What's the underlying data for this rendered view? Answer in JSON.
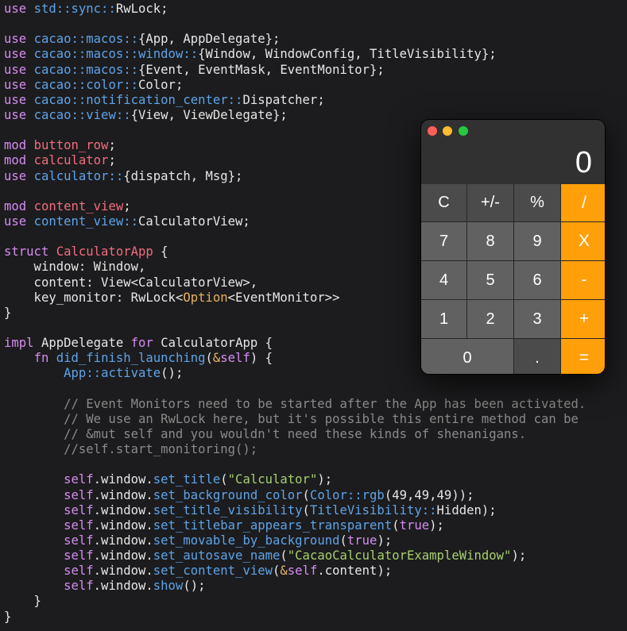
{
  "code_lines": [
    [
      [
        "kw",
        "use "
      ],
      [
        "ns",
        "std::sync::"
      ],
      [
        "pl",
        "RwLock;"
      ]
    ],
    [],
    [
      [
        "kw",
        "use "
      ],
      [
        "ns",
        "cacao::macos::"
      ],
      [
        "pl",
        "{App, AppDelegate};"
      ]
    ],
    [
      [
        "kw",
        "use "
      ],
      [
        "ns",
        "cacao::macos::window::"
      ],
      [
        "pl",
        "{Window, WindowConfig, TitleVisibility};"
      ]
    ],
    [
      [
        "kw",
        "use "
      ],
      [
        "ns",
        "cacao::macos::"
      ],
      [
        "pl",
        "{Event, EventMask, EventMonitor};"
      ]
    ],
    [
      [
        "kw",
        "use "
      ],
      [
        "ns",
        "cacao::color::"
      ],
      [
        "pl",
        "Color;"
      ]
    ],
    [
      [
        "kw",
        "use "
      ],
      [
        "ns",
        "cacao::notification_center::"
      ],
      [
        "pl",
        "Dispatcher;"
      ]
    ],
    [
      [
        "kw",
        "use "
      ],
      [
        "ns",
        "cacao::view::"
      ],
      [
        "pl",
        "{View, ViewDelegate};"
      ]
    ],
    [],
    [
      [
        "kw",
        "mod "
      ],
      [
        "name",
        "button_row"
      ],
      [
        "pl",
        ";"
      ]
    ],
    [
      [
        "kw",
        "mod "
      ],
      [
        "name",
        "calculator"
      ],
      [
        "pl",
        ";"
      ]
    ],
    [
      [
        "kw",
        "use "
      ],
      [
        "ns",
        "calculator::"
      ],
      [
        "pl",
        "{dispatch, Msg};"
      ]
    ],
    [],
    [
      [
        "kw",
        "mod "
      ],
      [
        "name",
        "content_view"
      ],
      [
        "pl",
        ";"
      ]
    ],
    [
      [
        "kw",
        "use "
      ],
      [
        "ns",
        "content_view::"
      ],
      [
        "pl",
        "CalculatorView;"
      ]
    ],
    [],
    [
      [
        "kw",
        "struct "
      ],
      [
        "name",
        "CalculatorApp"
      ],
      [
        "pl",
        " {"
      ]
    ],
    [
      [
        "pl",
        "    window: Window,"
      ]
    ],
    [
      [
        "pl",
        "    content: View<CalculatorView>,"
      ]
    ],
    [
      [
        "pl",
        "    key_monitor: RwLock<"
      ],
      [
        "opt",
        "Option"
      ],
      [
        "pl",
        "<EventMonitor>>"
      ]
    ],
    [
      [
        "pl",
        "}"
      ]
    ],
    [],
    [
      [
        "kw",
        "impl "
      ],
      [
        "pl",
        "AppDelegate "
      ],
      [
        "kw",
        "for "
      ],
      [
        "pl",
        "CalculatorApp {"
      ]
    ],
    [
      [
        "pl",
        "    "
      ],
      [
        "kw",
        "fn "
      ],
      [
        "fn",
        "did_finish_launching"
      ],
      [
        "pl",
        "("
      ],
      [
        "amp",
        "&"
      ],
      [
        "sf",
        "self"
      ],
      [
        "pl",
        ") {"
      ]
    ],
    [
      [
        "pl",
        "        "
      ],
      [
        "ns",
        "App::"
      ],
      [
        "fn",
        "activate"
      ],
      [
        "pl",
        "();"
      ]
    ],
    [],
    [
      [
        "cm",
        "        // Event Monitors need to be started after the App has been activated."
      ]
    ],
    [
      [
        "cm",
        "        // We use an RwLock here, but it's possible this entire method can be"
      ]
    ],
    [
      [
        "cm",
        "        // &mut self and you wouldn't need these kinds of shenanigans."
      ]
    ],
    [
      [
        "cm",
        "        //self.start_monitoring();"
      ]
    ],
    [],
    [
      [
        "pl",
        "        "
      ],
      [
        "sf",
        "self"
      ],
      [
        "pl",
        ".window."
      ],
      [
        "fn",
        "set_title"
      ],
      [
        "pl",
        "("
      ],
      [
        "str",
        "\"Calculator\""
      ],
      [
        "pl",
        ");"
      ]
    ],
    [
      [
        "pl",
        "        "
      ],
      [
        "sf",
        "self"
      ],
      [
        "pl",
        ".window."
      ],
      [
        "fn",
        "set_background_color"
      ],
      [
        "pl",
        "("
      ],
      [
        "ns",
        "Color::"
      ],
      [
        "fn",
        "rgb"
      ],
      [
        "pl",
        "(49,49,49));"
      ]
    ],
    [
      [
        "pl",
        "        "
      ],
      [
        "sf",
        "self"
      ],
      [
        "pl",
        ".window."
      ],
      [
        "fn",
        "set_title_visibility"
      ],
      [
        "pl",
        "("
      ],
      [
        "ns",
        "TitleVisibility::"
      ],
      [
        "pl",
        "Hidden);"
      ]
    ],
    [
      [
        "pl",
        "        "
      ],
      [
        "sf",
        "self"
      ],
      [
        "pl",
        ".window."
      ],
      [
        "fn",
        "set_titlebar_appears_transparent"
      ],
      [
        "pl",
        "("
      ],
      [
        "kw",
        "true"
      ],
      [
        "pl",
        ");"
      ]
    ],
    [
      [
        "pl",
        "        "
      ],
      [
        "sf",
        "self"
      ],
      [
        "pl",
        ".window."
      ],
      [
        "fn",
        "set_movable_by_background"
      ],
      [
        "pl",
        "("
      ],
      [
        "kw",
        "true"
      ],
      [
        "pl",
        ");"
      ]
    ],
    [
      [
        "pl",
        "        "
      ],
      [
        "sf",
        "self"
      ],
      [
        "pl",
        ".window."
      ],
      [
        "fn",
        "set_autosave_name"
      ],
      [
        "pl",
        "("
      ],
      [
        "str",
        "\"CacaoCalculatorExampleWindow\""
      ],
      [
        "pl",
        ");"
      ]
    ],
    [
      [
        "pl",
        "        "
      ],
      [
        "sf",
        "self"
      ],
      [
        "pl",
        ".window."
      ],
      [
        "fn",
        "set_content_view"
      ],
      [
        "pl",
        "("
      ],
      [
        "amp",
        "&"
      ],
      [
        "sf",
        "self"
      ],
      [
        "pl",
        ".content);"
      ]
    ],
    [
      [
        "pl",
        "        "
      ],
      [
        "sf",
        "self"
      ],
      [
        "pl",
        ".window."
      ],
      [
        "fn",
        "show"
      ],
      [
        "pl",
        "();"
      ]
    ],
    [
      [
        "pl",
        "    }"
      ]
    ],
    [
      [
        "pl",
        "}"
      ]
    ]
  ],
  "calculator": {
    "display_value": "0",
    "keys": [
      {
        "label": "C",
        "kind": "fn",
        "name": "clear-button"
      },
      {
        "label": "+/-",
        "kind": "fn",
        "name": "negate-button"
      },
      {
        "label": "%",
        "kind": "fn",
        "name": "percent-button"
      },
      {
        "label": "/",
        "kind": "op",
        "name": "divide-button"
      },
      {
        "label": "7",
        "kind": "num",
        "name": "digit-7-button"
      },
      {
        "label": "8",
        "kind": "num",
        "name": "digit-8-button"
      },
      {
        "label": "9",
        "kind": "num",
        "name": "digit-9-button"
      },
      {
        "label": "X",
        "kind": "op",
        "name": "multiply-button"
      },
      {
        "label": "4",
        "kind": "num",
        "name": "digit-4-button"
      },
      {
        "label": "5",
        "kind": "num",
        "name": "digit-5-button"
      },
      {
        "label": "6",
        "kind": "num",
        "name": "digit-6-button"
      },
      {
        "label": "-",
        "kind": "op",
        "name": "subtract-button"
      },
      {
        "label": "1",
        "kind": "num",
        "name": "digit-1-button"
      },
      {
        "label": "2",
        "kind": "num",
        "name": "digit-2-button"
      },
      {
        "label": "3",
        "kind": "num",
        "name": "digit-3-button"
      },
      {
        "label": "+",
        "kind": "op",
        "name": "add-button"
      },
      {
        "label": "0",
        "kind": "zero",
        "name": "digit-0-button"
      },
      {
        "label": ".",
        "kind": "fn",
        "name": "decimal-button"
      },
      {
        "label": "=",
        "kind": "op",
        "name": "equals-button"
      }
    ]
  }
}
